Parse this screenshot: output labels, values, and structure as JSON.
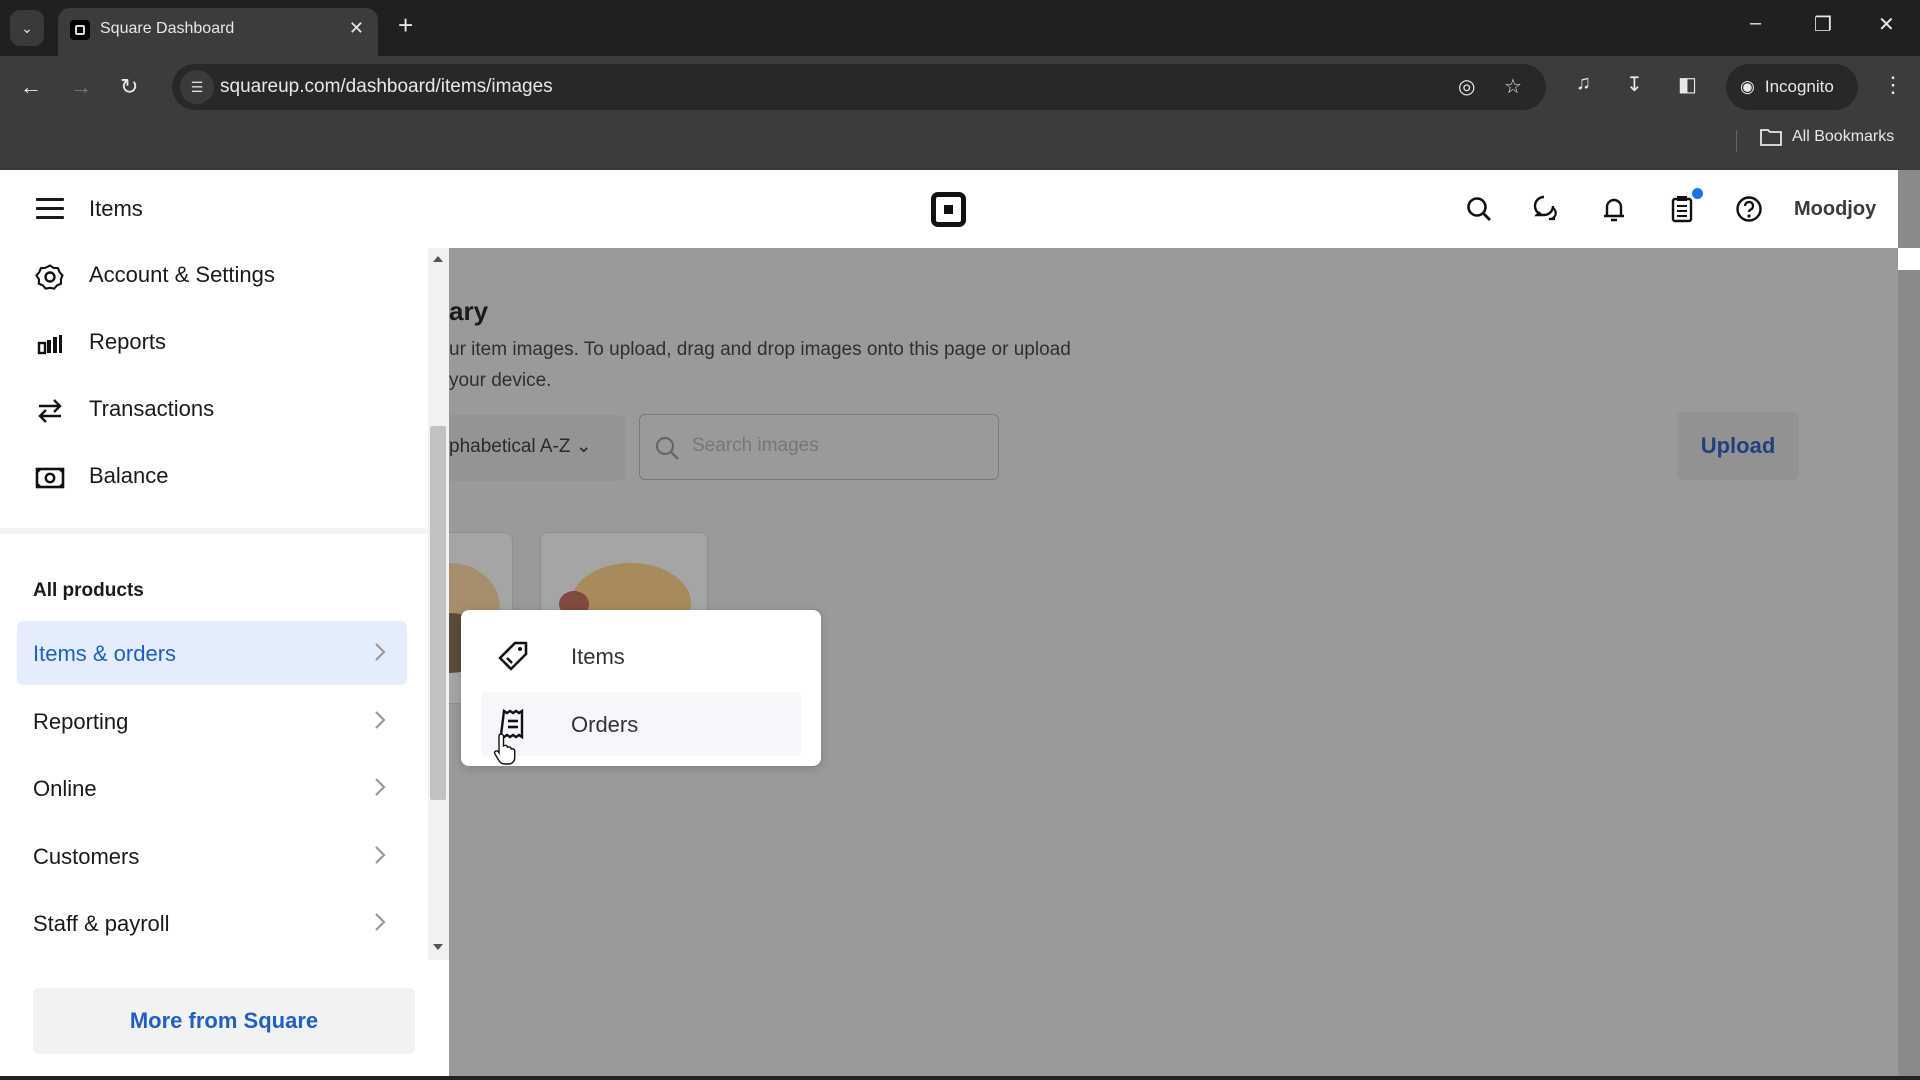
{
  "browser": {
    "tab_title": "Square Dashboard",
    "url": "squareup.com/dashboard/items/images",
    "profile_label": "Incognito",
    "bookmarks_label": "All Bookmarks"
  },
  "header": {
    "title": "Items",
    "user_name": "Moodjoy",
    "icons": [
      "search-icon",
      "messages-icon",
      "bell-icon",
      "clipboard-icon",
      "help-icon"
    ],
    "notification_dot_color": "#1a73e8"
  },
  "sidebar": {
    "top_items": [
      {
        "label": "Account & Settings",
        "icon": "gear-icon"
      },
      {
        "label": "Reports",
        "icon": "bar-chart-icon"
      },
      {
        "label": "Transactions",
        "icon": "transfer-arrows-icon"
      },
      {
        "label": "Balance",
        "icon": "banknote-icon"
      }
    ],
    "section_title": "All products",
    "product_items": [
      {
        "label": "Items & orders",
        "active": true
      },
      {
        "label": "Reporting",
        "active": false
      },
      {
        "label": "Online",
        "active": false
      },
      {
        "label": "Customers",
        "active": false
      },
      {
        "label": "Staff & payroll",
        "active": false
      }
    ],
    "more_button": "More from Square"
  },
  "main": {
    "title_partial": "ary",
    "description_line1": "ur item images. To upload, drag and drop images onto this page or upload",
    "description_line2": "your device.",
    "sort_value": "phabetical A-Z",
    "search_placeholder": "Search images",
    "upload_label": "Upload"
  },
  "flyout": {
    "items": [
      {
        "label": "Items",
        "icon": "tag-icon"
      },
      {
        "label": "Orders",
        "icon": "receipt-icon"
      }
    ]
  },
  "colors": {
    "accent_blue": "#1f5fbf",
    "active_bg": "#e3edfc",
    "overlay": "#9a9a9a"
  }
}
